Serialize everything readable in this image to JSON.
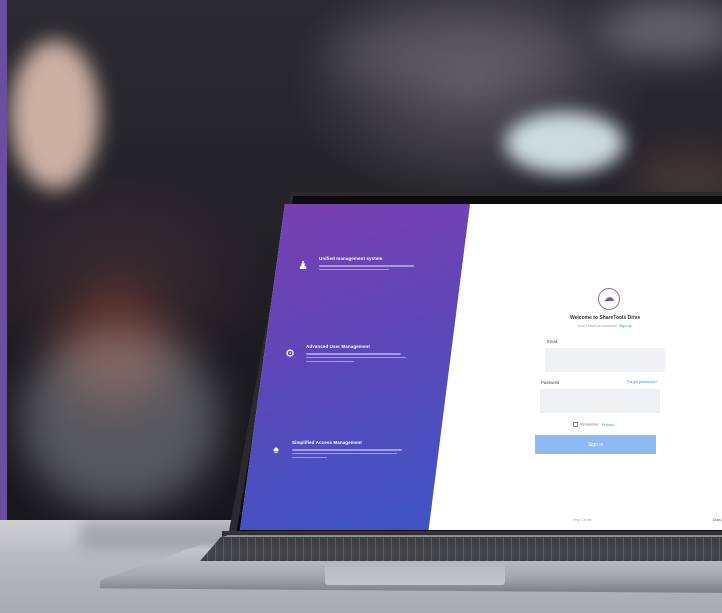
{
  "screen": {
    "features": [
      {
        "icon": "people-icon",
        "title": "Unified management system"
      },
      {
        "icon": "gear-icon",
        "title": "Advanced User Management"
      },
      {
        "icon": "user-icon",
        "title": "Simplified Access Management"
      }
    ],
    "login": {
      "title": "Welcome to ShareTools Drive",
      "subtitle": "Don't have an account?",
      "signup_link": "Sign up",
      "email_label": "Email",
      "password_label": "Password",
      "forgot_link": "Forgot password?",
      "remember_label": "Remember",
      "remember_link": "Privacy",
      "signin_label": "Sign in"
    },
    "footer_left": "Help Center",
    "footer_right": "Docs"
  },
  "colors": {
    "panel_start": "#7b3fb0",
    "panel_end": "#3c56c6",
    "button": "#8dbaf2",
    "link": "#3a8cf0"
  }
}
